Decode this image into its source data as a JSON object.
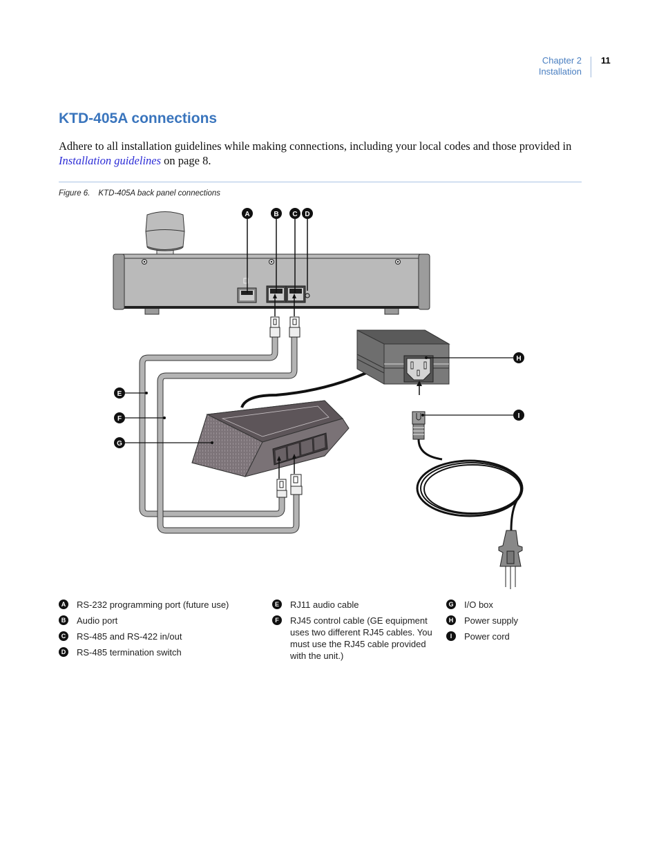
{
  "header": {
    "chapter": "Chapter 2",
    "section": "Installation",
    "page_number": "11"
  },
  "title": "KTD-405A connections",
  "intro": {
    "text_before": "Adhere to all installation guidelines while making connections, including your local codes and those provided in ",
    "link_text": "Installation guidelines",
    "text_after": " on page 8."
  },
  "figure": {
    "number": "Figure 6.",
    "caption": "KTD-405A back panel connections",
    "callouts": [
      "A",
      "B",
      "C",
      "D",
      "E",
      "F",
      "G",
      "H",
      "I"
    ]
  },
  "legend": {
    "column1": [
      {
        "key": "A",
        "label": "RS-232 programming port (future use)"
      },
      {
        "key": "B",
        "label": "Audio port"
      },
      {
        "key": "C",
        "label": "RS-485 and RS-422 in/out"
      },
      {
        "key": "D",
        "label": "RS-485 termination switch"
      }
    ],
    "column2": [
      {
        "key": "E",
        "label": "RJ11 audio cable"
      },
      {
        "key": "F",
        "label": "RJ45 control cable (GE equipment uses two different RJ45 cables. You must use the RJ45 cable provided with the unit.)"
      }
    ],
    "column3": [
      {
        "key": "G",
        "label": "I/O box"
      },
      {
        "key": "H",
        "label": "Power supply"
      },
      {
        "key": "I",
        "label": "Power cord"
      }
    ]
  },
  "colors": {
    "heading_blue": "#3a75bd",
    "link_blue": "#2b2bd6",
    "rule_blue": "#a9c3e4"
  }
}
